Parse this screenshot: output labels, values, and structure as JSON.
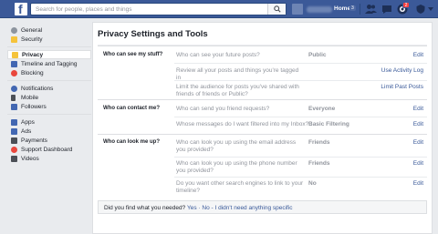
{
  "topbar": {
    "logo_letter": "f",
    "search_placeholder": "Search for people, places and things",
    "home_label": "Home",
    "home_count": "3",
    "notifications_badge": "2"
  },
  "sidebar": {
    "groups": [
      [
        {
          "label": "General",
          "icon": "gear-icon",
          "color": "#8d949e"
        },
        {
          "label": "Security",
          "icon": "shield-icon",
          "color": "#f5c33b"
        }
      ],
      [
        {
          "label": "Privacy",
          "icon": "lock-icon",
          "color": "#f5c33b",
          "active": true
        },
        {
          "label": "Timeline and Tagging",
          "icon": "timeline-icon",
          "color": "#4267b2"
        },
        {
          "label": "Blocking",
          "icon": "block-icon",
          "color": "#e9473d"
        }
      ],
      [
        {
          "label": "Notifications",
          "icon": "globe-icon",
          "color": "#4267b2"
        },
        {
          "label": "Mobile",
          "icon": "mobile-icon",
          "color": "#4b4f56"
        },
        {
          "label": "Followers",
          "icon": "rss-icon",
          "color": "#4267b2"
        }
      ],
      [
        {
          "label": "Apps",
          "icon": "apps-icon",
          "color": "#4267b2"
        },
        {
          "label": "Ads",
          "icon": "ads-icon",
          "color": "#4267b2"
        },
        {
          "label": "Payments",
          "icon": "payments-icon",
          "color": "#4b4f56"
        },
        {
          "label": "Support Dashboard",
          "icon": "lifebuoy-icon",
          "color": "#e9473d"
        },
        {
          "label": "Videos",
          "icon": "video-icon",
          "color": "#4b4f56"
        }
      ]
    ]
  },
  "main": {
    "title": "Privacy Settings and Tools",
    "sections": [
      {
        "label": "Who can see my stuff?",
        "rows": [
          {
            "question": "Who can see your future posts?",
            "value": "Public",
            "action": "Edit"
          },
          {
            "question": "Review all your posts and things you're tagged in",
            "value": "",
            "action": "Use Activity Log"
          },
          {
            "question": "Limit the audience for posts you've shared with friends of friends or Public?",
            "value": "",
            "action": "Limit Past Posts"
          }
        ]
      },
      {
        "label": "Who can contact me?",
        "rows": [
          {
            "question": "Who can send you friend requests?",
            "value": "Everyone",
            "action": "Edit"
          },
          {
            "question": "Whose messages do I want filtered into my Inbox?",
            "value": "Basic Filtering",
            "action": "Edit"
          }
        ]
      },
      {
        "label": "Who can look me up?",
        "rows": [
          {
            "question": "Who can look you up using the email address you provided?",
            "value": "Friends",
            "action": "Edit"
          },
          {
            "question": "Who can look you up using the phone number you provided?",
            "value": "Friends",
            "action": "Edit"
          },
          {
            "question": "Do you want other search engines to link to your timeline?",
            "value": "No",
            "action": "Edit"
          }
        ]
      }
    ],
    "feedback": {
      "question": "Did you find what you needed?",
      "yes": "Yes",
      "no": "No - I didn't need anything specific",
      "separator": "·"
    }
  }
}
